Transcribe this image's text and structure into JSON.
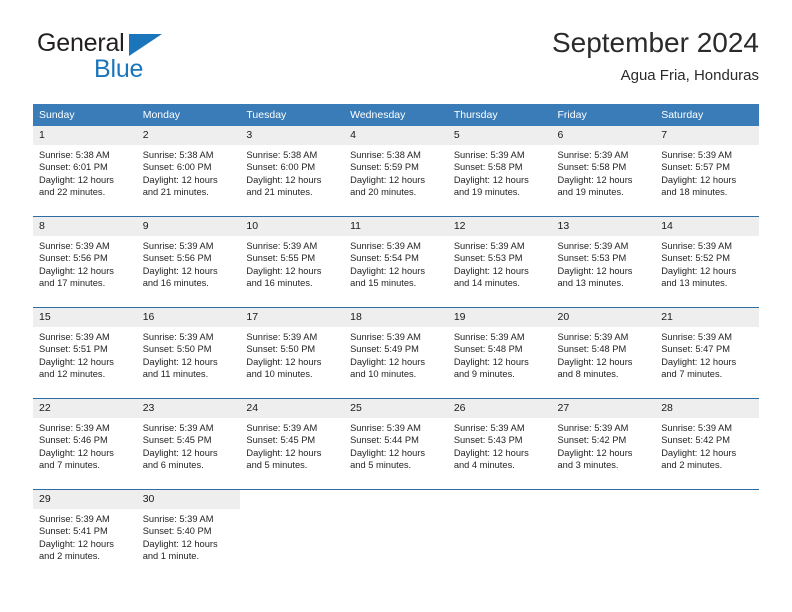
{
  "brand": {
    "name_top": "General",
    "name_bottom": "Blue",
    "triangle_icon": "triangle-logo-icon",
    "accent_color": "#1b75bb"
  },
  "header": {
    "title": "September 2024",
    "subtitle": "Agua Fria, Honduras"
  },
  "theme": {
    "header_bg": "#3a7cb8",
    "header_text": "#ffffff",
    "row_divider": "#2e6da4",
    "daynum_bg": "#eeeeee",
    "body_text": "#242424"
  },
  "weekdays": [
    "Sunday",
    "Monday",
    "Tuesday",
    "Wednesday",
    "Thursday",
    "Friday",
    "Saturday"
  ],
  "weeks": [
    [
      {
        "day": "1",
        "sunrise": "Sunrise: 5:38 AM",
        "sunset": "Sunset: 6:01 PM",
        "daylight1": "Daylight: 12 hours",
        "daylight2": "and 22 minutes."
      },
      {
        "day": "2",
        "sunrise": "Sunrise: 5:38 AM",
        "sunset": "Sunset: 6:00 PM",
        "daylight1": "Daylight: 12 hours",
        "daylight2": "and 21 minutes."
      },
      {
        "day": "3",
        "sunrise": "Sunrise: 5:38 AM",
        "sunset": "Sunset: 6:00 PM",
        "daylight1": "Daylight: 12 hours",
        "daylight2": "and 21 minutes."
      },
      {
        "day": "4",
        "sunrise": "Sunrise: 5:38 AM",
        "sunset": "Sunset: 5:59 PM",
        "daylight1": "Daylight: 12 hours",
        "daylight2": "and 20 minutes."
      },
      {
        "day": "5",
        "sunrise": "Sunrise: 5:39 AM",
        "sunset": "Sunset: 5:58 PM",
        "daylight1": "Daylight: 12 hours",
        "daylight2": "and 19 minutes."
      },
      {
        "day": "6",
        "sunrise": "Sunrise: 5:39 AM",
        "sunset": "Sunset: 5:58 PM",
        "daylight1": "Daylight: 12 hours",
        "daylight2": "and 19 minutes."
      },
      {
        "day": "7",
        "sunrise": "Sunrise: 5:39 AM",
        "sunset": "Sunset: 5:57 PM",
        "daylight1": "Daylight: 12 hours",
        "daylight2": "and 18 minutes."
      }
    ],
    [
      {
        "day": "8",
        "sunrise": "Sunrise: 5:39 AM",
        "sunset": "Sunset: 5:56 PM",
        "daylight1": "Daylight: 12 hours",
        "daylight2": "and 17 minutes."
      },
      {
        "day": "9",
        "sunrise": "Sunrise: 5:39 AM",
        "sunset": "Sunset: 5:56 PM",
        "daylight1": "Daylight: 12 hours",
        "daylight2": "and 16 minutes."
      },
      {
        "day": "10",
        "sunrise": "Sunrise: 5:39 AM",
        "sunset": "Sunset: 5:55 PM",
        "daylight1": "Daylight: 12 hours",
        "daylight2": "and 16 minutes."
      },
      {
        "day": "11",
        "sunrise": "Sunrise: 5:39 AM",
        "sunset": "Sunset: 5:54 PM",
        "daylight1": "Daylight: 12 hours",
        "daylight2": "and 15 minutes."
      },
      {
        "day": "12",
        "sunrise": "Sunrise: 5:39 AM",
        "sunset": "Sunset: 5:53 PM",
        "daylight1": "Daylight: 12 hours",
        "daylight2": "and 14 minutes."
      },
      {
        "day": "13",
        "sunrise": "Sunrise: 5:39 AM",
        "sunset": "Sunset: 5:53 PM",
        "daylight1": "Daylight: 12 hours",
        "daylight2": "and 13 minutes."
      },
      {
        "day": "14",
        "sunrise": "Sunrise: 5:39 AM",
        "sunset": "Sunset: 5:52 PM",
        "daylight1": "Daylight: 12 hours",
        "daylight2": "and 13 minutes."
      }
    ],
    [
      {
        "day": "15",
        "sunrise": "Sunrise: 5:39 AM",
        "sunset": "Sunset: 5:51 PM",
        "daylight1": "Daylight: 12 hours",
        "daylight2": "and 12 minutes."
      },
      {
        "day": "16",
        "sunrise": "Sunrise: 5:39 AM",
        "sunset": "Sunset: 5:50 PM",
        "daylight1": "Daylight: 12 hours",
        "daylight2": "and 11 minutes."
      },
      {
        "day": "17",
        "sunrise": "Sunrise: 5:39 AM",
        "sunset": "Sunset: 5:50 PM",
        "daylight1": "Daylight: 12 hours",
        "daylight2": "and 10 minutes."
      },
      {
        "day": "18",
        "sunrise": "Sunrise: 5:39 AM",
        "sunset": "Sunset: 5:49 PM",
        "daylight1": "Daylight: 12 hours",
        "daylight2": "and 10 minutes."
      },
      {
        "day": "19",
        "sunrise": "Sunrise: 5:39 AM",
        "sunset": "Sunset: 5:48 PM",
        "daylight1": "Daylight: 12 hours",
        "daylight2": "and 9 minutes."
      },
      {
        "day": "20",
        "sunrise": "Sunrise: 5:39 AM",
        "sunset": "Sunset: 5:48 PM",
        "daylight1": "Daylight: 12 hours",
        "daylight2": "and 8 minutes."
      },
      {
        "day": "21",
        "sunrise": "Sunrise: 5:39 AM",
        "sunset": "Sunset: 5:47 PM",
        "daylight1": "Daylight: 12 hours",
        "daylight2": "and 7 minutes."
      }
    ],
    [
      {
        "day": "22",
        "sunrise": "Sunrise: 5:39 AM",
        "sunset": "Sunset: 5:46 PM",
        "daylight1": "Daylight: 12 hours",
        "daylight2": "and 7 minutes."
      },
      {
        "day": "23",
        "sunrise": "Sunrise: 5:39 AM",
        "sunset": "Sunset: 5:45 PM",
        "daylight1": "Daylight: 12 hours",
        "daylight2": "and 6 minutes."
      },
      {
        "day": "24",
        "sunrise": "Sunrise: 5:39 AM",
        "sunset": "Sunset: 5:45 PM",
        "daylight1": "Daylight: 12 hours",
        "daylight2": "and 5 minutes."
      },
      {
        "day": "25",
        "sunrise": "Sunrise: 5:39 AM",
        "sunset": "Sunset: 5:44 PM",
        "daylight1": "Daylight: 12 hours",
        "daylight2": "and 5 minutes."
      },
      {
        "day": "26",
        "sunrise": "Sunrise: 5:39 AM",
        "sunset": "Sunset: 5:43 PM",
        "daylight1": "Daylight: 12 hours",
        "daylight2": "and 4 minutes."
      },
      {
        "day": "27",
        "sunrise": "Sunrise: 5:39 AM",
        "sunset": "Sunset: 5:42 PM",
        "daylight1": "Daylight: 12 hours",
        "daylight2": "and 3 minutes."
      },
      {
        "day": "28",
        "sunrise": "Sunrise: 5:39 AM",
        "sunset": "Sunset: 5:42 PM",
        "daylight1": "Daylight: 12 hours",
        "daylight2": "and 2 minutes."
      }
    ],
    [
      {
        "day": "29",
        "sunrise": "Sunrise: 5:39 AM",
        "sunset": "Sunset: 5:41 PM",
        "daylight1": "Daylight: 12 hours",
        "daylight2": "and 2 minutes."
      },
      {
        "day": "30",
        "sunrise": "Sunrise: 5:39 AM",
        "sunset": "Sunset: 5:40 PM",
        "daylight1": "Daylight: 12 hours",
        "daylight2": "and 1 minute."
      },
      {
        "day": "",
        "sunrise": "",
        "sunset": "",
        "daylight1": "",
        "daylight2": ""
      },
      {
        "day": "",
        "sunrise": "",
        "sunset": "",
        "daylight1": "",
        "daylight2": ""
      },
      {
        "day": "",
        "sunrise": "",
        "sunset": "",
        "daylight1": "",
        "daylight2": ""
      },
      {
        "day": "",
        "sunrise": "",
        "sunset": "",
        "daylight1": "",
        "daylight2": ""
      },
      {
        "day": "",
        "sunrise": "",
        "sunset": "",
        "daylight1": "",
        "daylight2": ""
      }
    ]
  ]
}
